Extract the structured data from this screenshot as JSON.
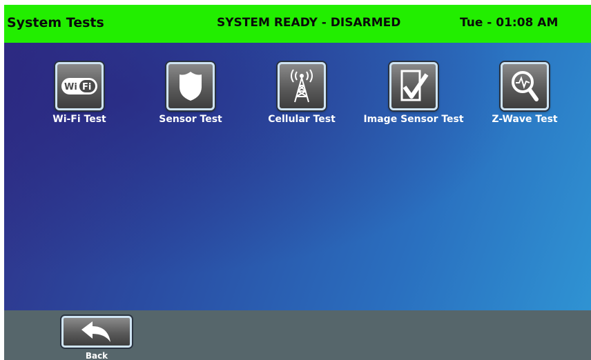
{
  "header": {
    "title": "System Tests",
    "status": "SYSTEM READY - DISARMED",
    "clock": "Tue - 01:08 AM"
  },
  "tests": [
    {
      "label": "Wi-Fi Test",
      "icon": "wifi-icon",
      "glyph": "Wi Fi"
    },
    {
      "label": "Sensor Test",
      "icon": "shield-icon"
    },
    {
      "label": "Cellular Test",
      "icon": "cell-tower-icon"
    },
    {
      "label": "Image Sensor Test",
      "icon": "image-sensor-check-icon"
    },
    {
      "label": "Z-Wave Test",
      "icon": "magnifier-pulse-icon"
    }
  ],
  "footer": {
    "back_label": "Back",
    "back_icon": "back-arrow-icon"
  },
  "colors": {
    "header_bg": "#22ee00",
    "footer_bg": "#56666b",
    "button_border": "#cfe4f3"
  }
}
